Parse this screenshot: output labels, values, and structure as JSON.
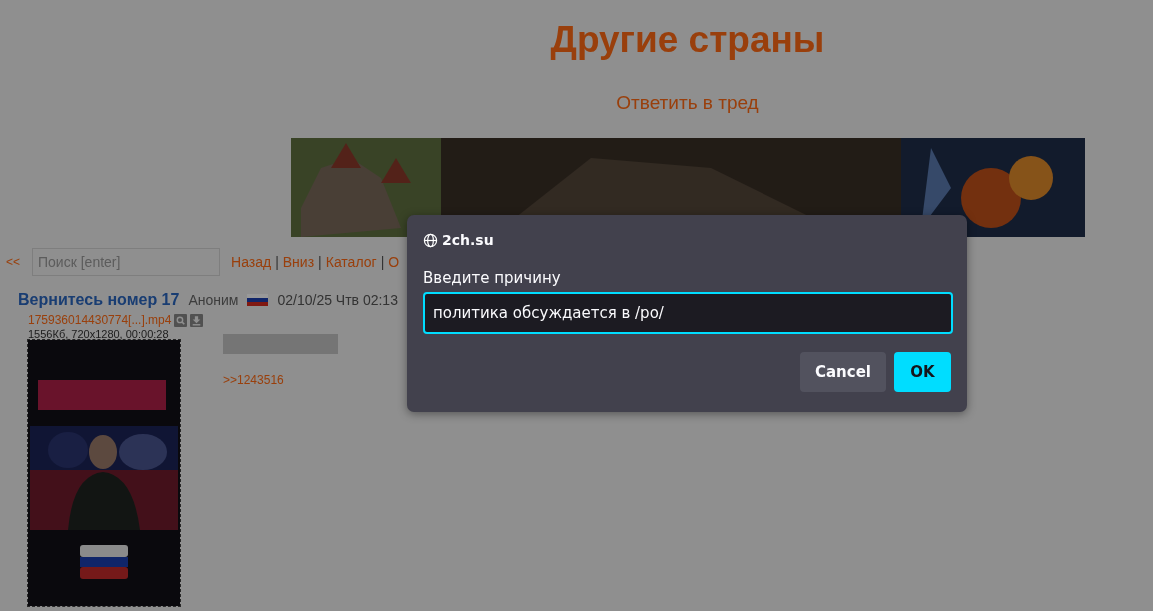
{
  "page": {
    "title": "Другие страны",
    "reply_link": "Ответить в тред"
  },
  "nav": {
    "back": "<<",
    "search": {
      "placeholder": "Поиск [enter]"
    },
    "separator": "|",
    "links": [
      "Назад",
      "Вниз",
      "Каталог",
      "О"
    ]
  },
  "post": {
    "subject": "Вернитесь номер 17",
    "author": "Аноним",
    "date": "02/10/25 Чтв 02:13",
    "file": {
      "name": "175936014430774[...].mp4",
      "info": "1556Кб, 720x1280, 00:00:28"
    },
    "reply_ref": ">>1243516"
  },
  "dialog": {
    "site": "2ch.su",
    "label": "Введите причину",
    "value": "политика обсуждается в /po/",
    "buttons": [
      {
        "label": "Cancel",
        "kind": "secondary"
      },
      {
        "label": "OK",
        "kind": "primary"
      }
    ]
  }
}
